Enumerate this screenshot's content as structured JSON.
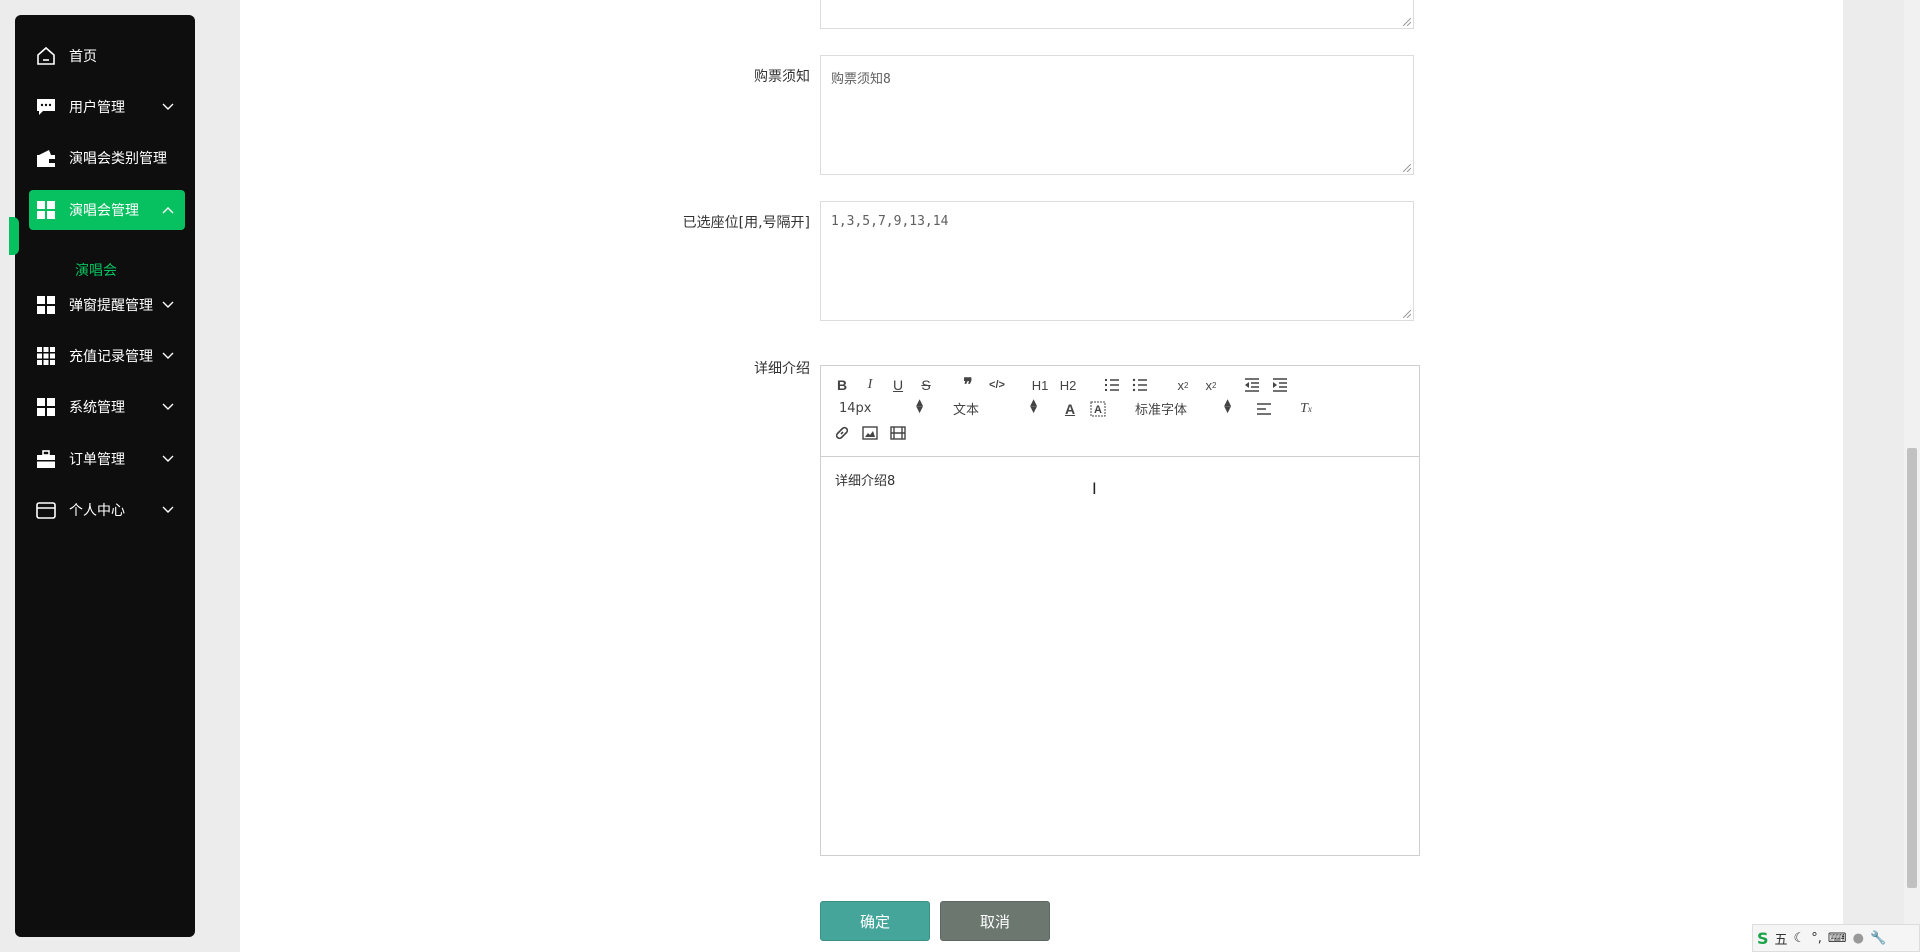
{
  "sidebar": {
    "items": [
      {
        "label": "首页",
        "icon": "home-icon",
        "has_arrow": false
      },
      {
        "label": "用户管理",
        "icon": "chat-icon",
        "has_arrow": true
      },
      {
        "label": "演唱会类别管理",
        "icon": "wallet-icon",
        "has_arrow": true
      },
      {
        "label": "演唱会管理",
        "icon": "grid-icon",
        "has_arrow": true,
        "active": true
      },
      {
        "label": "弹窗提醒管理",
        "icon": "grid-icon",
        "has_arrow": true
      },
      {
        "label": "充值记录管理",
        "icon": "grid9-icon",
        "has_arrow": true
      },
      {
        "label": "系统管理",
        "icon": "grid-icon",
        "has_arrow": true
      },
      {
        "label": "订单管理",
        "icon": "briefcase-icon",
        "has_arrow": true
      },
      {
        "label": "个人中心",
        "icon": "card-icon",
        "has_arrow": true
      }
    ],
    "sub_item": "演唱会",
    "accent_color": "#07c160"
  },
  "form": {
    "notice_label": "购票须知",
    "notice_value": "购票须知8",
    "seats_label": "已选座位[用,号隔开]",
    "seats_value": "1,3,5,7,9,13,14",
    "detail_label": "详细介绍",
    "detail_value": "详细介绍8"
  },
  "editor": {
    "font_size": "14px",
    "heading": "文本",
    "font_family": "标准字体",
    "h1": "H1",
    "h2": "H2"
  },
  "buttons": {
    "confirm": "确定",
    "cancel": "取消"
  },
  "ime": {
    "mode": "五"
  }
}
